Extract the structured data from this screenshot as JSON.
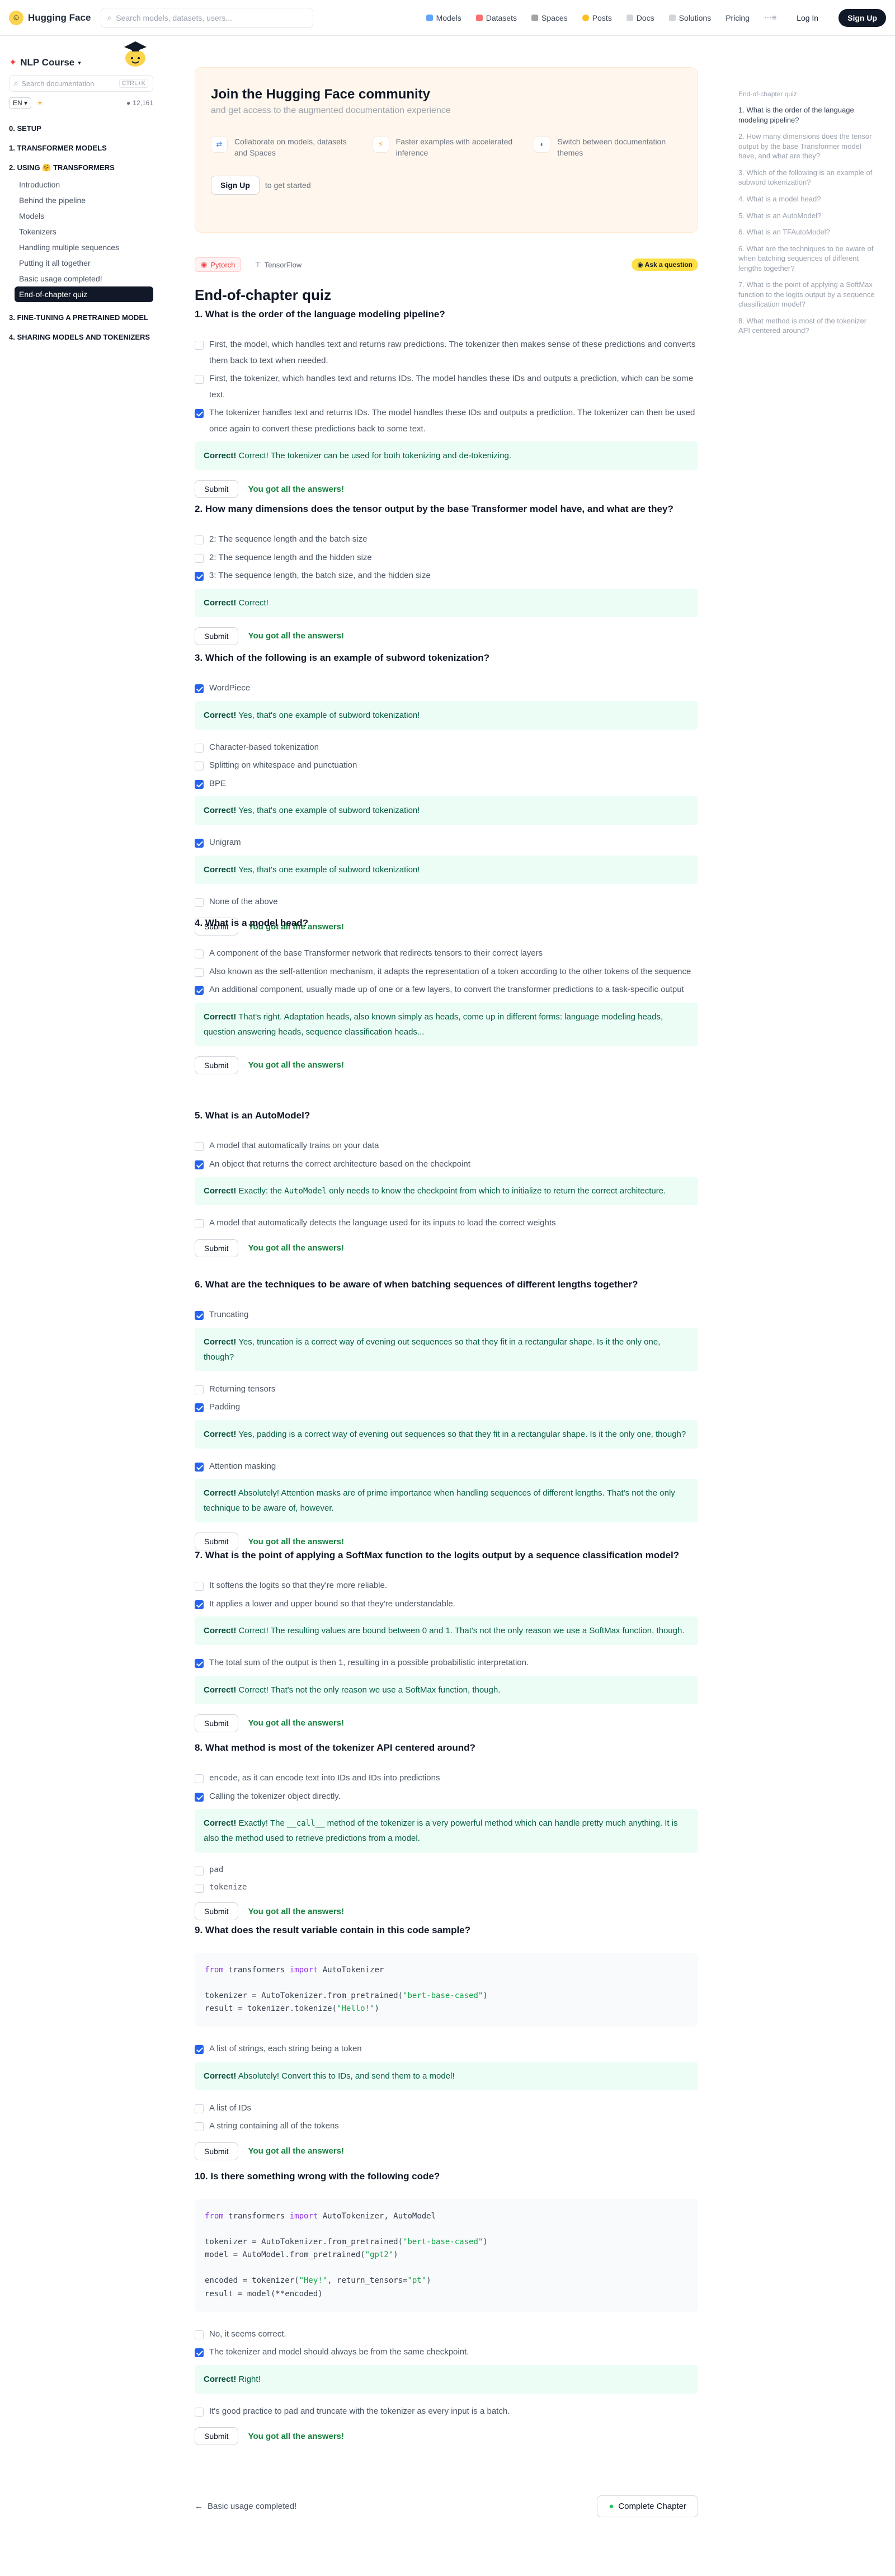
{
  "nav": {
    "brand": "Hugging Face",
    "search_placeholder": "Search models, datasets, users...",
    "links": [
      "Models",
      "Datasets",
      "Spaces",
      "Posts",
      "Docs",
      "Solutions",
      "Pricing"
    ],
    "login": "Log In",
    "signup": "Sign Up"
  },
  "sidebar": {
    "course": "NLP Course",
    "search_placeholder": "Search documentation",
    "search_kbd": "CTRL+K",
    "lang": "EN",
    "github_count": "12,161",
    "sections": [
      {
        "label": "0. SETUP",
        "subs": []
      },
      {
        "label": "1. TRANSFORMER MODELS",
        "subs": []
      },
      {
        "label": "2. USING 🤗 TRANSFORMERS",
        "subs": [
          "Introduction",
          "Behind the pipeline",
          "Models",
          "Tokenizers",
          "Handling multiple sequences",
          "Putting it all together",
          "Basic usage completed!",
          "End-of-chapter quiz"
        ]
      },
      {
        "label": "3. FINE-TUNING A PRETRAINED MODEL",
        "subs": []
      },
      {
        "label": "4. SHARING MODELS AND TOKENIZERS",
        "subs": []
      }
    ]
  },
  "community": {
    "title": "Join the Hugging Face community",
    "subtitle": "and get access to the augmented documentation experience",
    "features": [
      "Collaborate on models, datasets and Spaces",
      "Faster examples with accelerated inference",
      "Switch between documentation themes"
    ],
    "signup": "Sign Up",
    "get_started": "to get started"
  },
  "frameworks": {
    "pytorch": "Pytorch",
    "tensorflow": "TensorFlow",
    "ask": "Ask a question"
  },
  "page_title": "End-of-chapter quiz",
  "toc": {
    "header": "End-of-chapter quiz",
    "items": [
      "1. What is the order of the language modeling pipeline?",
      "2. How many dimensions does the tensor output by the base Transformer model have, and what are they?",
      "3. Which of the following is an example of subword tokenization?",
      "4. What is a model head?",
      "5. What is an AutoModel?",
      "6. What is an TFAutoModel?",
      "6. What are the techniques to be aware of when batching sequences of different lengths together?",
      "7. What is the point of applying a SoftMax function to the logits output by a sequence classification model?",
      "8. What method is most of the tokenizer API centered around?"
    ]
  },
  "common": {
    "submit": "Submit",
    "all_answers": "You got all the answers!"
  },
  "q1": {
    "title": "1. What is the order of the language modeling pipeline?",
    "o1": "First, the model, which handles text and returns raw predictions. The tokenizer then makes sense of these predictions and converts them back to text when needed.",
    "o2": "First, the tokenizer, which handles text and returns IDs. The model handles these IDs and outputs a prediction, which can be some text.",
    "o3": "The tokenizer handles text and returns IDs. The model handles these IDs and outputs a prediction. The tokenizer can then be used once again to convert these predictions back to some text.",
    "fb_label": "Correct!",
    "fb": "Correct! The tokenizer can be used for both tokenizing and de-tokenizing."
  },
  "q2": {
    "title": "2. How many dimensions does the tensor output by the base Transformer model have, and what are they?",
    "o1": "2: The sequence length and the batch size",
    "o2": "2: The sequence length and the hidden size",
    "o3": "3: The sequence length, the batch size, and the hidden size",
    "fb_label": "Correct!",
    "fb": "Correct!"
  },
  "q3": {
    "title": "3. Which of the following is an example of subword tokenization?",
    "o1": "WordPiece",
    "o2": "Character-based tokenization",
    "o3": "Splitting on whitespace and punctuation",
    "o4": "BPE",
    "o5": "Unigram",
    "o6": "None of the above",
    "fb_label": "Correct!",
    "fb": "Yes, that's one example of subword tokenization!"
  },
  "q4": {
    "title": "4. What is a model head?",
    "o1": "A component of the base Transformer network that redirects tensors to their correct layers",
    "o2": "Also known as the self-attention mechanism, it adapts the representation of a token according to the other tokens of the sequence",
    "o3": "An additional component, usually made up of one or a few layers, to convert the transformer predictions to a task-specific output",
    "fb_label": "Correct!",
    "fb": "That's right. Adaptation heads, also known simply as heads, come up in different forms: language modeling heads, question answering heads, sequence classification heads..."
  },
  "q5": {
    "title": "5. What is an AutoModel?",
    "o1": "A model that automatically trains on your data",
    "o2": "An object that returns the correct architecture based on the checkpoint",
    "o3": "A model that automatically detects the language used for its inputs to load the correct weights",
    "fb_label": "Correct!",
    "fb_pre": "Exactly: the ",
    "fb_code": "AutoModel",
    "fb_post": " only needs to know the checkpoint from which to initialize to return the correct architecture."
  },
  "q6": {
    "title": "6. What are the techniques to be aware of when batching sequences of different lengths together?",
    "o1": "Truncating",
    "o2": "Returning tensors",
    "o3": "Padding",
    "o4": "Attention masking",
    "fb_label": "Correct!",
    "fb1": "Yes, truncation is a correct way of evening out sequences so that they fit in a rectangular shape. Is it the only one, though?",
    "fb2": "Yes, padding is a correct way of evening out sequences so that they fit in a rectangular shape. Is it the only one, though?",
    "fb3": "Absolutely! Attention masks are of prime importance when handling sequences of different lengths. That's not the only technique to be aware of, however."
  },
  "q7": {
    "title": "7. What is the point of applying a SoftMax function to the logits output by a sequence classification model?",
    "o1": "It softens the logits so that they're more reliable.",
    "o2": "It applies a lower and upper bound so that they're understandable.",
    "o3": "The total sum of the output is then 1, resulting in a possible probabilistic interpretation.",
    "fb_label": "Correct!",
    "fb1": "Correct! The resulting values are bound between 0 and 1. That's not the only reason we use a SoftMax function, though.",
    "fb2": "Correct! That's not the only reason we use a SoftMax function, though."
  },
  "q8": {
    "title": "8. What method is most of the tokenizer API centered around?",
    "o1_code": "encode",
    "o1": ", as it can encode text into IDs and IDs into predictions",
    "o2": "Calling the tokenizer object directly.",
    "o3": "pad",
    "o4": "tokenize",
    "fb_label": "Correct!",
    "fb_pre": "Exactly! The ",
    "fb_code": "__call__",
    "fb_post": " method of the tokenizer is a very powerful method which can handle pretty much anything. It is also the method used to retrieve predictions from a model."
  },
  "q9": {
    "title": "9. What does the result variable contain in this code sample?",
    "code": {
      "l1_from": "from",
      "l1_mod": " transformers ",
      "l1_import": "import",
      "l1_rest": " AutoTokenizer",
      "l2": "tokenizer = AutoTokenizer.from_pretrained(",
      "l2_str": "\"bert-base-cased\"",
      "l2_end": ")",
      "l3": "result = tokenizer.tokenize(",
      "l3_str": "\"Hello!\"",
      "l3_end": ")"
    },
    "o1": "A list of strings, each string being a token",
    "o2": "A list of IDs",
    "o3": "A string containing all of the tokens",
    "fb_label": "Correct!",
    "fb": "Absolutely! Convert this to IDs, and send them to a model!"
  },
  "q10": {
    "title": "10. Is there something wrong with the following code?",
    "code": {
      "l1_from": "from",
      "l1_mod": " transformers ",
      "l1_import": "import",
      "l1_rest": " AutoTokenizer, AutoModel",
      "l2": "tokenizer = AutoTokenizer.from_pretrained(",
      "l2_str": "\"bert-base-cased\"",
      "l2_end": ")",
      "l3": "model = AutoModel.from_pretrained(",
      "l3_str": "\"gpt2\"",
      "l3_end": ")",
      "l4": "encoded = tokenizer(",
      "l4_str": "\"Hey!\"",
      "l4_mid": ", return_tensors=",
      "l4_str2": "\"pt\"",
      "l4_end": ")",
      "l5": "result = model(**encoded)"
    },
    "o1": "No, it seems correct.",
    "o2": "The tokenizer and model should always be from the same checkpoint.",
    "o3": "It's good practice to pad and truncate with the tokenizer as every input is a batch.",
    "fb_label": "Correct!",
    "fb": "Right!"
  },
  "footer": {
    "prev": "Basic usage completed!",
    "next": "Complete Chapter"
  }
}
